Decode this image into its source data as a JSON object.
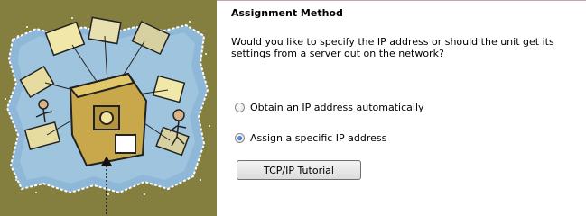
{
  "page": {
    "heading": "Assignment Method",
    "question": "Would you like to specify the IP address or should the unit get its settings from a server out on the network?",
    "options": [
      {
        "label": "Obtain an IP address automatically",
        "selected": false
      },
      {
        "label": "Assign a specific IP address",
        "selected": true
      }
    ],
    "tutorial_button_label": "TCP/IP Tutorial"
  },
  "colors": {
    "art_background": "#857f3f",
    "map_fill": "#8fb8d8",
    "robot_fill": "#c8a84a",
    "rule": "#c9a7a7"
  },
  "icons": [
    "network-illustration-icon",
    "radio-unchecked-icon",
    "radio-checked-icon"
  ]
}
